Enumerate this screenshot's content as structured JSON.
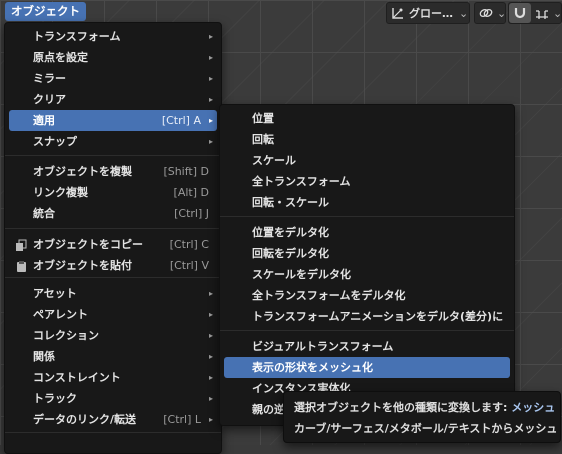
{
  "header": {
    "menu_label": "オブジェクト",
    "transform_orientation": "グロー…",
    "colors": {
      "accent": "#4772b3",
      "menu_bg": "#181818"
    }
  },
  "object_menu": {
    "items": [
      {
        "label": "トランスフォーム",
        "arrow": "▸"
      },
      {
        "label": "原点を設定",
        "arrow": "▸"
      },
      {
        "label": "ミラー",
        "arrow": "▸"
      },
      {
        "label": "クリア",
        "arrow": "▸"
      },
      {
        "label": "適用",
        "shortcut": "[Ctrl] A",
        "arrow": "▸",
        "highlighted": true
      },
      {
        "label": "スナップ",
        "arrow": "▸"
      },
      {
        "label": "オブジェクトを複製",
        "shortcut": "[Shift] D"
      },
      {
        "label": "リンク複製",
        "shortcut": "[Alt] D"
      },
      {
        "label": "統合",
        "shortcut": "[Ctrl] J"
      },
      {
        "label": "オブジェクトをコピー",
        "shortcut": "[Ctrl] C",
        "icon": "copy-icon"
      },
      {
        "label": "オブジェクトを貼付",
        "shortcut": "[Ctrl] V",
        "icon": "paste-icon"
      },
      {
        "label": "アセット",
        "arrow": "▸"
      },
      {
        "label": "ペアレント",
        "arrow": "▸"
      },
      {
        "label": "コレクション",
        "arrow": "▸"
      },
      {
        "label": "関係",
        "arrow": "▸"
      },
      {
        "label": "コンストレイント",
        "arrow": "▸"
      },
      {
        "label": "トラック",
        "arrow": "▸"
      },
      {
        "label": "データのリンク/転送",
        "shortcut": "[Ctrl] L",
        "arrow": "▸"
      }
    ]
  },
  "apply_submenu": {
    "items": [
      {
        "label": "位置"
      },
      {
        "label": "回転"
      },
      {
        "label": "スケール"
      },
      {
        "label": "全トランスフォーム"
      },
      {
        "label": "回転・スケール"
      },
      {
        "label": "位置をデルタ化"
      },
      {
        "label": "回転をデルタ化"
      },
      {
        "label": "スケールをデルタ化"
      },
      {
        "label": "全トランスフォームをデルタ化"
      },
      {
        "label": "トランスフォームアニメーションをデルタ(差分)に"
      },
      {
        "label": "ビジュアルトランスフォーム"
      },
      {
        "label": "表示の形状をメッシュ化",
        "highlighted": true
      },
      {
        "label": "インスタンス実体化"
      },
      {
        "label": "親の逆"
      }
    ]
  },
  "tooltip": {
    "line1_text": "選択オブジェクトを他の種類に変換します:",
    "line1_accent": "メッシュ",
    "line2_text": "カーブ/サーフェス/メタボール/テキストからメッシュ"
  }
}
